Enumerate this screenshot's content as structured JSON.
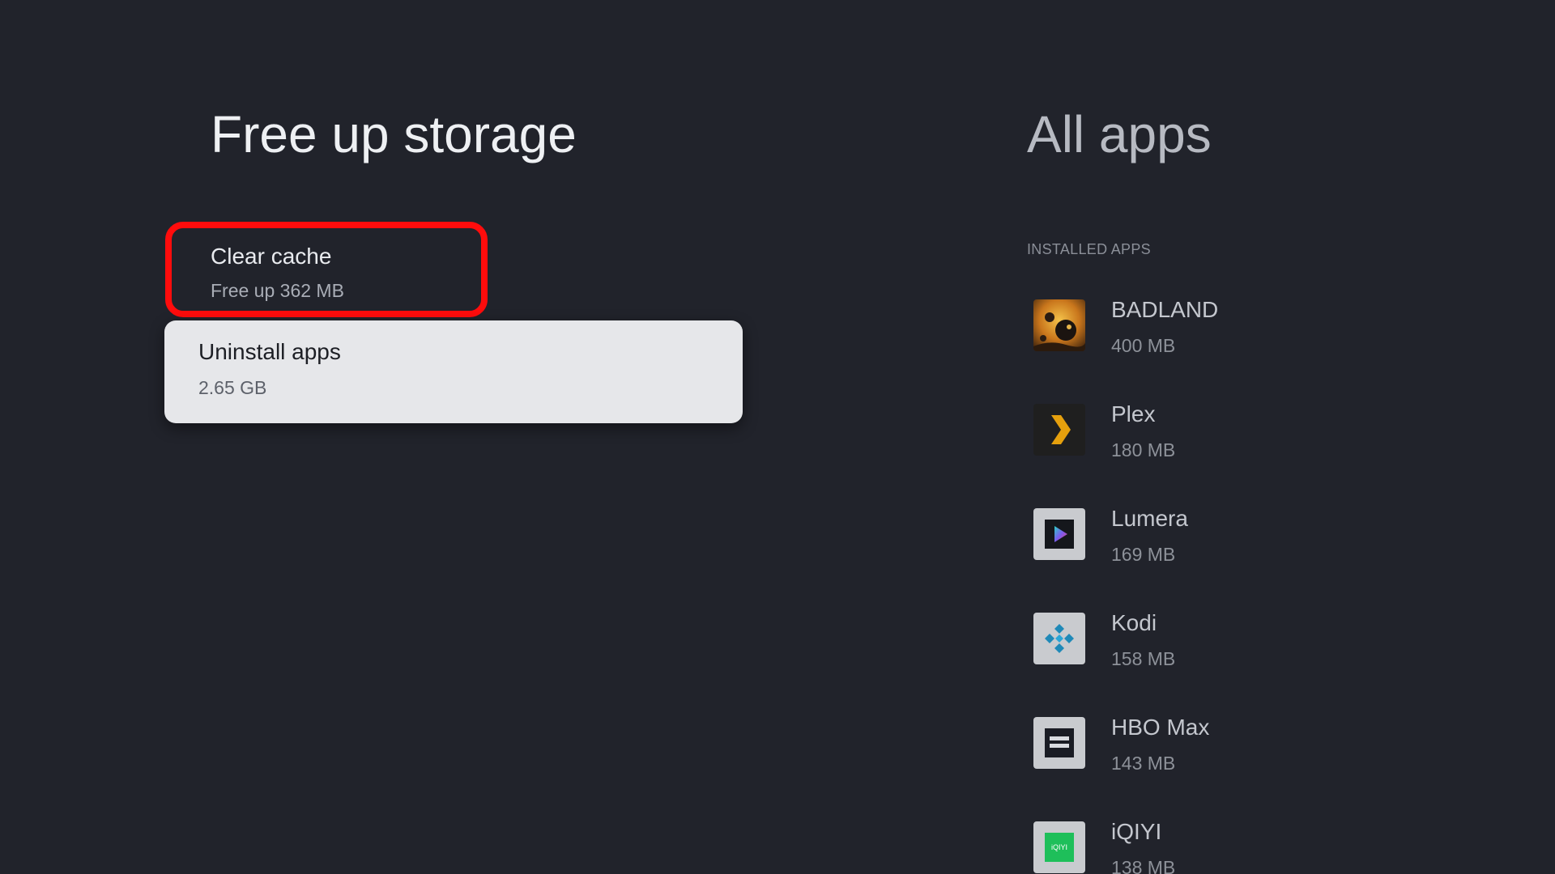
{
  "left_panel": {
    "title": "Free up storage",
    "clear_cache": {
      "title": "Clear cache",
      "subtitle": "Free up 362 MB"
    },
    "uninstall_apps": {
      "title": "Uninstall apps",
      "subtitle": "2.65 GB"
    }
  },
  "right_panel": {
    "title": "All apps",
    "section_header": "INSTALLED APPS",
    "apps": [
      {
        "name": "BADLAND",
        "size": "400 MB",
        "icon": "badland-icon"
      },
      {
        "name": "Plex",
        "size": "180 MB",
        "icon": "plex-icon"
      },
      {
        "name": "Lumera",
        "size": "169 MB",
        "icon": "lumera-icon"
      },
      {
        "name": "Kodi",
        "size": "158 MB",
        "icon": "kodi-icon"
      },
      {
        "name": "HBO Max",
        "size": "143 MB",
        "icon": "hbo-max-icon"
      },
      {
        "name": "iQIYI",
        "size": "138 MB",
        "icon": "iqiyi-icon",
        "icon_text": "iQIYI"
      }
    ]
  },
  "colors": {
    "background": "#21232b",
    "highlight_border": "#ff0c0c",
    "focused_card": "#e6e7ea"
  }
}
